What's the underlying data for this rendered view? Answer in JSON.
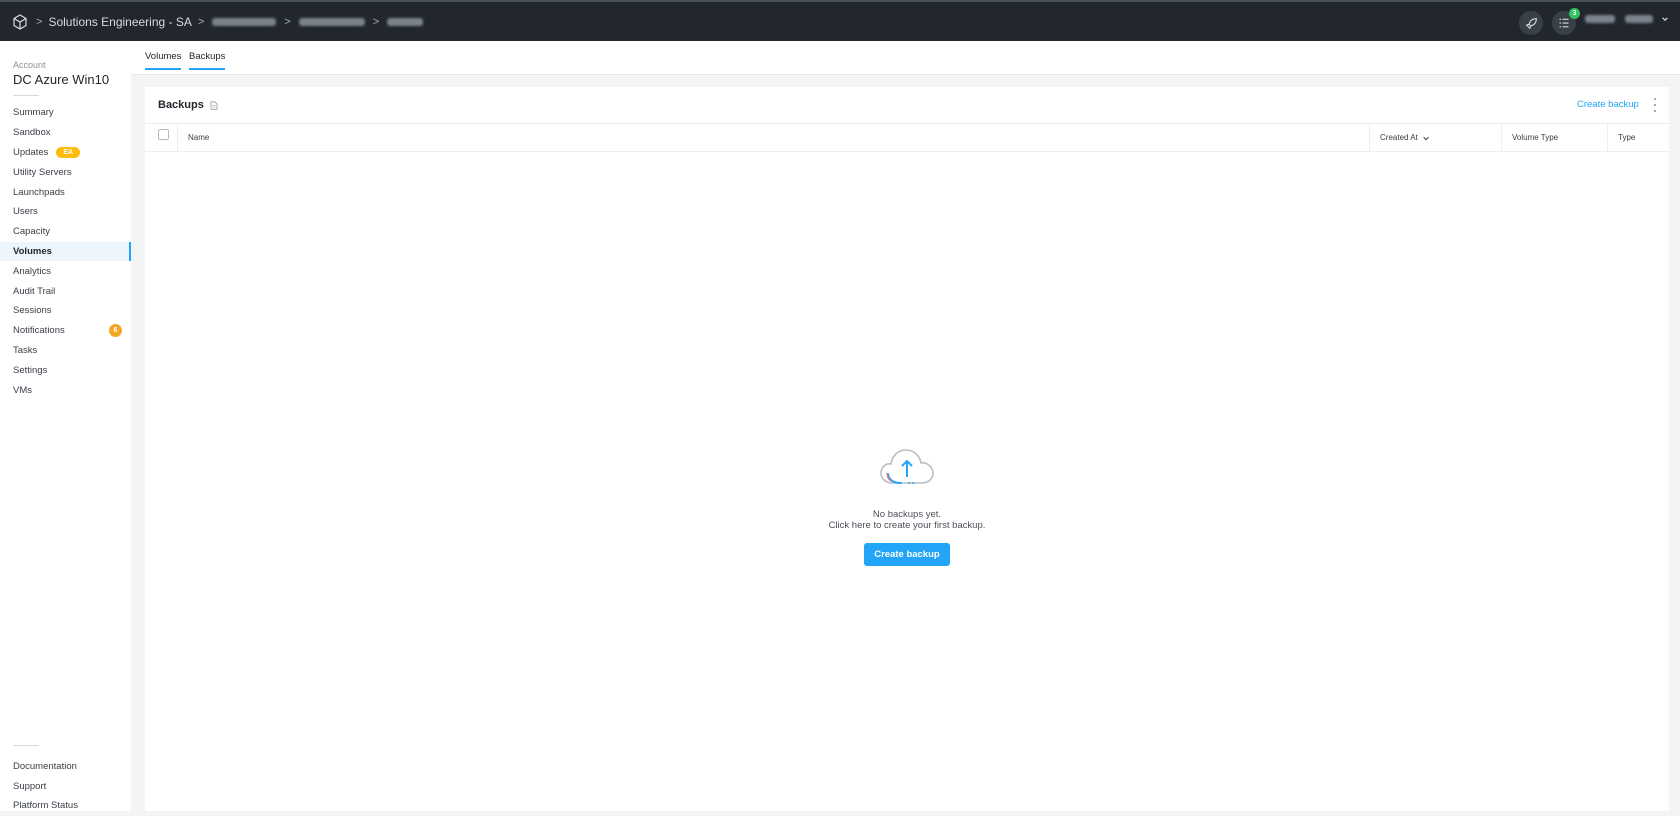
{
  "header": {
    "breadcrumbs": [
      "Solutions Engineering - SA"
    ],
    "notification_count": "3",
    "icons": [
      "cube-logo-icon",
      "rocket-icon",
      "task-list-icon",
      "chevron-down-icon"
    ]
  },
  "account": {
    "label": "Account",
    "name": "DC Azure Win10"
  },
  "sidebar": {
    "items": [
      {
        "label": "Summary"
      },
      {
        "label": "Sandbox"
      },
      {
        "label": "Updates",
        "badge": "EA"
      },
      {
        "label": "Utility Servers"
      },
      {
        "label": "Launchpads"
      },
      {
        "label": "Users"
      },
      {
        "label": "Capacity"
      },
      {
        "label": "Volumes",
        "active": true
      },
      {
        "label": "Analytics"
      },
      {
        "label": "Audit Trail"
      },
      {
        "label": "Sessions"
      },
      {
        "label": "Notifications",
        "count": "6"
      },
      {
        "label": "Tasks"
      },
      {
        "label": "Settings"
      },
      {
        "label": "VMs"
      }
    ],
    "bottom_items": [
      {
        "label": "Documentation"
      },
      {
        "label": "Support"
      },
      {
        "label": "Platform Status"
      }
    ]
  },
  "tabs": [
    {
      "label": "Volumes"
    },
    {
      "label": "Backups",
      "active": true
    }
  ],
  "backups": {
    "title": "Backups",
    "create_link": "Create backup",
    "columns": [
      "Name",
      "Created At",
      "Volume Type",
      "Type"
    ],
    "empty_line1": "No backups yet.",
    "empty_line2": "Click here to create your first backup.",
    "create_button": "Create backup"
  },
  "colors": {
    "topbar": "#22272e",
    "accent": "#22a5f7",
    "badge_ea": "#ffbc0b",
    "badge_count": "#f5a623",
    "notif_dot": "#33c15e"
  }
}
